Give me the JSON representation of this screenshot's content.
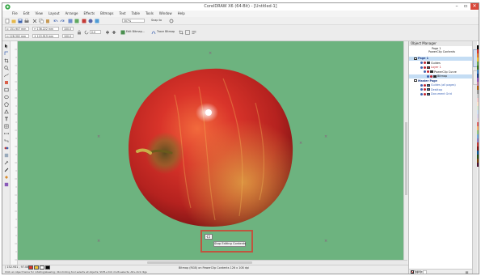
{
  "window": {
    "title": "CorelDRAW X6 (64-Bit) - [Untitled-1]",
    "min_glyph": "–",
    "max_glyph": "▫",
    "close_glyph": "✕"
  },
  "menu": {
    "items": [
      "File",
      "Edit",
      "View",
      "Layout",
      "Arrange",
      "Effects",
      "Bitmaps",
      "Text",
      "Table",
      "Tools",
      "Window",
      "Help"
    ]
  },
  "toolbar": {
    "zoom": "307%",
    "snap_to": "Snap to",
    "x_pos": "x: 151.907 mm",
    "y_pos": "y: 128.302 mm",
    "width": "↔ 136.222 mm",
    "height": "↕ 115.919 mm",
    "scale_w": "100.0",
    "scale_h": "100.0",
    "rotation": "0.0",
    "edit_bitmap": "Edit Bitmap...",
    "trace_bitmap": "Trace Bitmap"
  },
  "canvas": {
    "background": "#6db37f",
    "handle_glyph": "×"
  },
  "tooltip": {
    "text": "Stop Editing Contents"
  },
  "object_manager": {
    "title": "Object Manager",
    "page_header": "Page 1",
    "page_subheader": "PowerClip Contents",
    "tree": [
      {
        "label": "Page 1",
        "indent": 0,
        "selected": true,
        "color": "#1f3f8a",
        "bold": true
      },
      {
        "label": "Guides",
        "indent": 2,
        "selected": false,
        "color": "#222222",
        "bold": false
      },
      {
        "label": "Layer 1",
        "indent": 2,
        "selected": false,
        "color": "#c0232c",
        "bold": false
      },
      {
        "label": "PowerClip Curve",
        "indent": 3,
        "selected": false,
        "color": "#222222",
        "bold": false
      },
      {
        "label": "Bitmap",
        "indent": 4,
        "selected": true,
        "color": "#222222",
        "bold": false
      },
      {
        "label": "Master Page",
        "indent": 0,
        "selected": false,
        "color": "#1f3f8a",
        "bold": true
      },
      {
        "label": "Guides (all pages)",
        "indent": 2,
        "selected": false,
        "color": "#3e66b8",
        "bold": false
      },
      {
        "label": "Desktop",
        "indent": 2,
        "selected": false,
        "color": "#3e66b8",
        "bold": false
      },
      {
        "label": "Document Grid",
        "indent": 2,
        "selected": false,
        "color": "#3e66b8",
        "bold": false
      }
    ]
  },
  "status": {
    "coords": "( 152.931 , 97.084 )",
    "hint": "Click an object twice for rotating/skewing; dbl-clicking tool selects all objects; Shift+click multi-selects; Alt+click digs",
    "selection": "Bitmap (RGB) on PowerClip Contents 126 x 108 dpi",
    "fill_label": "None"
  },
  "colors": {
    "accent": "#c0553f",
    "selection": "#c4ddf4",
    "layer_red": "#c0232c"
  }
}
